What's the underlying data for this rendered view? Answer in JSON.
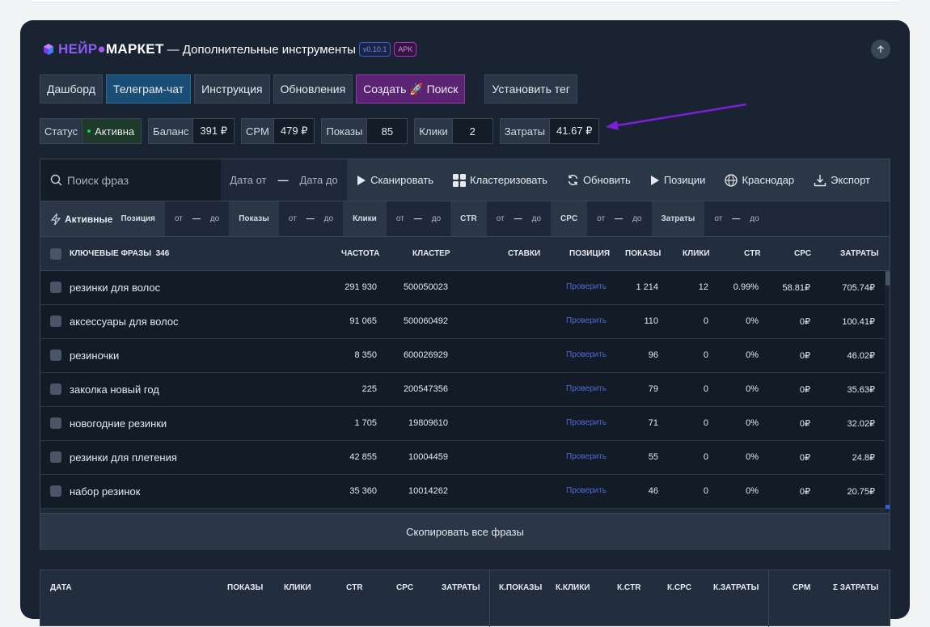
{
  "header": {
    "brand_part1": "НЕЙР",
    "brand_part2": "●",
    "brand_part3": "МАРКЕТ",
    "title_rest": "— Дополнительные инструменты",
    "version_badge": "v0.10.1",
    "apk_badge": "APK"
  },
  "nav": {
    "dashboard": "Дашборд",
    "telegram": "Телеграм-чат",
    "instruction": "Инструкция",
    "updates": "Обновления",
    "create_search": "Создать 🚀 Поиск",
    "set_tag": "Установить тег"
  },
  "stats": {
    "status_label": "Статус",
    "status_value": "Активна",
    "balance_label": "Баланс",
    "balance_value": "391 ₽",
    "cpm_label": "CPM",
    "cpm_value": "479 ₽",
    "views_label": "Показы",
    "views_value": "85",
    "clicks_label": "Клики",
    "clicks_value": "2",
    "costs_label": "Затраты",
    "costs_value": "41.67 ₽"
  },
  "toolbar": {
    "search_placeholder": "Поиск фраз",
    "date_from": "Дата от",
    "date_to": "Дата до",
    "scan": "Сканировать",
    "cluster": "Кластеризовать",
    "refresh": "Обновить",
    "positions": "Позиции",
    "region": "Краснодар",
    "export": "Экспорт"
  },
  "filters": {
    "active": "Активные",
    "position": "Позиция",
    "views": "Показы",
    "clicks": "Клики",
    "ctr": "CTR",
    "cpc": "CPC",
    "costs": "Затраты",
    "from": "от",
    "to": "до"
  },
  "table": {
    "headers": {
      "phrases": "КЛЮЧЕВЫЕ ФРАЗЫ",
      "count": "346",
      "frequency": "ЧАСТОТА",
      "cluster": "КЛАСТЕР",
      "bids": "СТАВКИ",
      "position": "ПОЗИЦИЯ",
      "views": "ПОКАЗЫ",
      "clicks": "КЛИКИ",
      "ctr": "CTR",
      "cpc": "CPC",
      "costs": "ЗАТРАТЫ"
    },
    "check_label": "Проверить",
    "rows": [
      {
        "phrase": "резинки для волос",
        "freq": "291 930",
        "cluster": "500050023",
        "views": "1 214",
        "clicks": "12",
        "ctr": "0.99%",
        "cpc": "58.81₽",
        "costs": "705.74₽"
      },
      {
        "phrase": "аксессуары для волос",
        "freq": "91 065",
        "cluster": "500060492",
        "views": "110",
        "clicks": "0",
        "ctr": "0%",
        "cpc": "0₽",
        "costs": "100.41₽"
      },
      {
        "phrase": "резиночки",
        "freq": "8 350",
        "cluster": "600026929",
        "views": "96",
        "clicks": "0",
        "ctr": "0%",
        "cpc": "0₽",
        "costs": "46.02₽"
      },
      {
        "phrase": "заколка новый год",
        "freq": "225",
        "cluster": "200547356",
        "views": "79",
        "clicks": "0",
        "ctr": "0%",
        "cpc": "0₽",
        "costs": "35.63₽"
      },
      {
        "phrase": "новогодние резинки",
        "freq": "1 705",
        "cluster": "19809610",
        "views": "71",
        "clicks": "0",
        "ctr": "0%",
        "cpc": "0₽",
        "costs": "32.02₽"
      },
      {
        "phrase": "резинки для плетения",
        "freq": "42 855",
        "cluster": "10004459",
        "views": "55",
        "clicks": "0",
        "ctr": "0%",
        "cpc": "0₽",
        "costs": "24.8₽"
      },
      {
        "phrase": "набор резинок",
        "freq": "35 360",
        "cluster": "10014262",
        "views": "46",
        "clicks": "0",
        "ctr": "0%",
        "cpc": "0₽",
        "costs": "20.75₽"
      }
    ],
    "copy_all": "Скопировать все фразы"
  },
  "bottom_table": {
    "date": "ДАТА",
    "views": "ПОКАЗЫ",
    "clicks": "КЛИКИ",
    "ctr": "CTR",
    "cpc": "CPC",
    "costs": "ЗАТРАТЫ",
    "k_views": "К.ПОКАЗЫ",
    "k_clicks": "К.КЛИКИ",
    "k_ctr": "К.CTR",
    "k_cpc": "К.CPC",
    "k_costs": "К.ЗАТРАТЫ",
    "cpm": "CPM",
    "sum_costs": "Σ ЗАТРАТЫ"
  }
}
